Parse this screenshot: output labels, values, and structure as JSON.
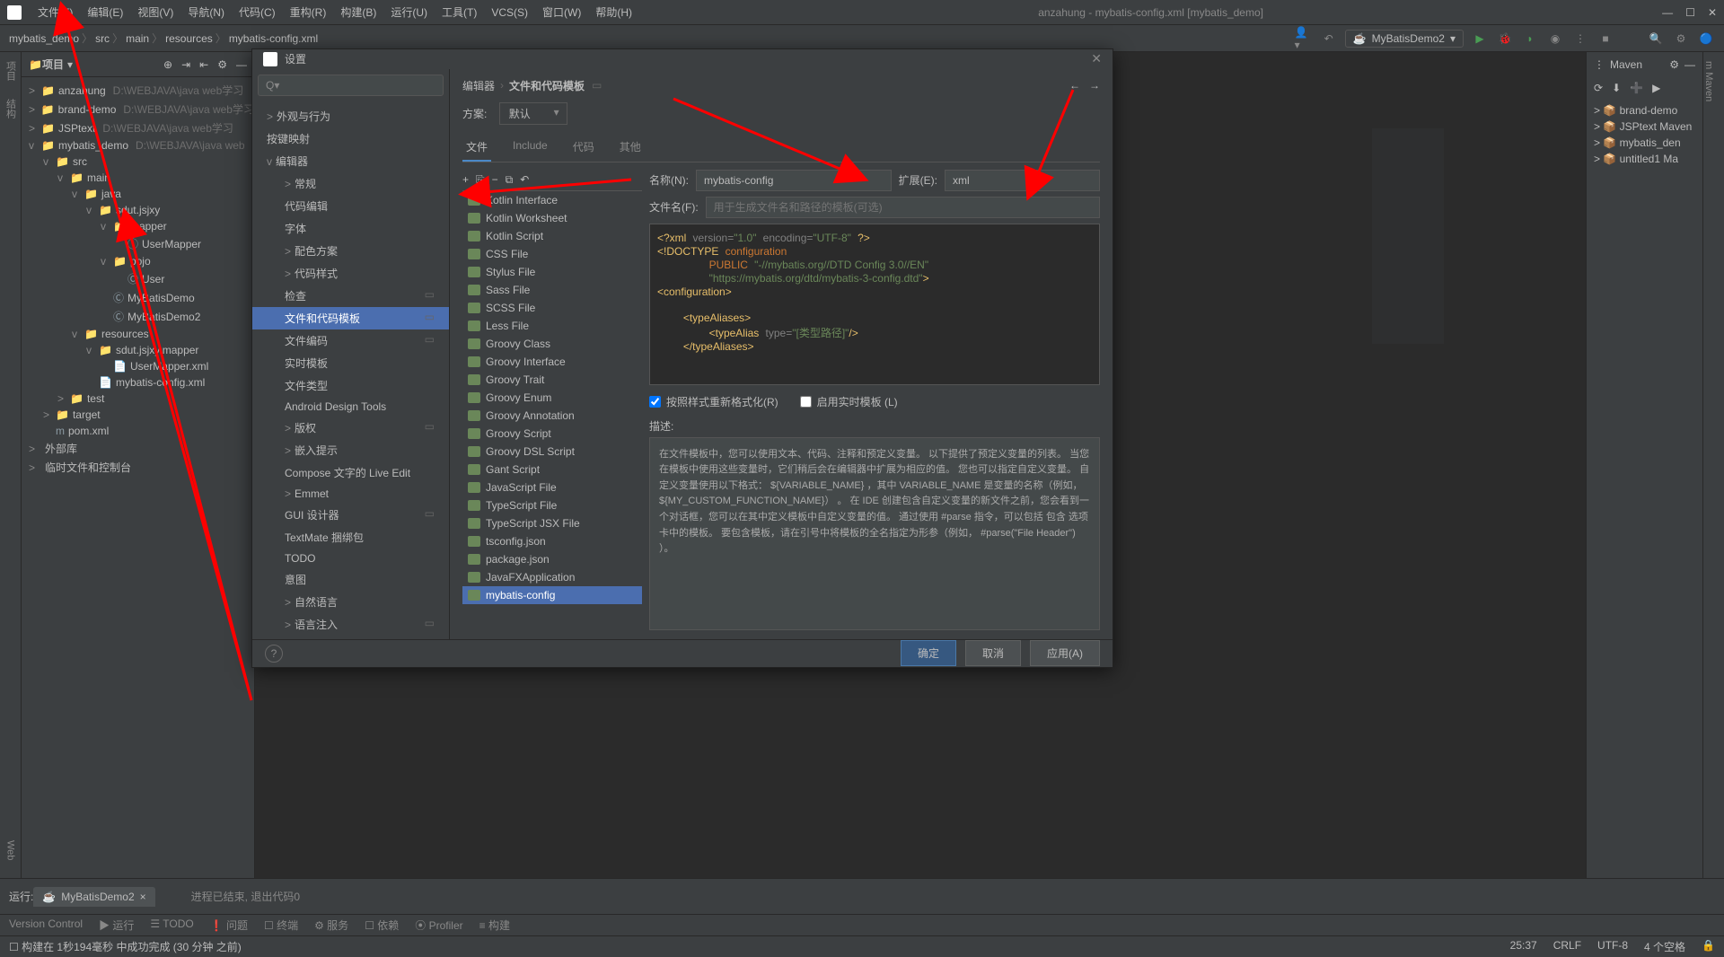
{
  "title_center": "anzahung - mybatis-config.xml [mybatis_demo]",
  "menu": [
    "文件(F)",
    "编辑(E)",
    "视图(V)",
    "导航(N)",
    "代码(C)",
    "重构(R)",
    "构建(B)",
    "运行(U)",
    "工具(T)",
    "VCS(S)",
    "窗口(W)",
    "帮助(H)"
  ],
  "breadcrumbs": [
    "mybatis_demo",
    "src",
    "main",
    "resources",
    "mybatis-config.xml"
  ],
  "run_config": "MyBatisDemo2",
  "maven_label": "Maven",
  "project_label": "项目",
  "project_tree": [
    {
      "lvl": 0,
      "arrow": ">",
      "icon": "📁",
      "name": "anzahung",
      "path": "D:\\WEBJAVA\\java web学习"
    },
    {
      "lvl": 0,
      "arrow": ">",
      "icon": "📁",
      "name": "brand-demo",
      "path": "D:\\WEBJAVA\\java web学习"
    },
    {
      "lvl": 0,
      "arrow": ">",
      "icon": "📁",
      "name": "JSPtext",
      "path": "D:\\WEBJAVA\\java web学习"
    },
    {
      "lvl": 0,
      "arrow": "v",
      "icon": "📁",
      "name": "mybatis_demo",
      "path": "D:\\WEBJAVA\\java web"
    },
    {
      "lvl": 1,
      "arrow": "v",
      "icon": "📁",
      "name": "src"
    },
    {
      "lvl": 2,
      "arrow": "v",
      "icon": "📁",
      "name": "main"
    },
    {
      "lvl": 3,
      "arrow": "v",
      "icon": "📁",
      "name": "java"
    },
    {
      "lvl": 4,
      "arrow": "v",
      "icon": "📁",
      "name": "sdut.jsjxy"
    },
    {
      "lvl": 5,
      "arrow": "v",
      "icon": "📁",
      "name": "mapper"
    },
    {
      "lvl": 6,
      "arrow": "",
      "icon": "Ⓘ",
      "name": "UserMapper"
    },
    {
      "lvl": 5,
      "arrow": "v",
      "icon": "📁",
      "name": "pojo"
    },
    {
      "lvl": 6,
      "arrow": "",
      "icon": "Ⓒ",
      "name": "User"
    },
    {
      "lvl": 5,
      "arrow": "",
      "icon": "Ⓒ",
      "name": "MyBatisDemo"
    },
    {
      "lvl": 5,
      "arrow": "",
      "icon": "Ⓒ",
      "name": "MyBatisDemo2"
    },
    {
      "lvl": 3,
      "arrow": "v",
      "icon": "📁",
      "name": "resources"
    },
    {
      "lvl": 4,
      "arrow": "v",
      "icon": "📁",
      "name": "sdut.jsjxy.mapper"
    },
    {
      "lvl": 5,
      "arrow": "",
      "icon": "📄",
      "name": "UserMapper.xml"
    },
    {
      "lvl": 4,
      "arrow": "",
      "icon": "📄",
      "name": "mybatis-config.xml"
    },
    {
      "lvl": 2,
      "arrow": ">",
      "icon": "📁",
      "name": "test"
    },
    {
      "lvl": 1,
      "arrow": ">",
      "icon": "📁",
      "name": "target"
    },
    {
      "lvl": 1,
      "arrow": "",
      "icon": "m",
      "name": "pom.xml"
    },
    {
      "lvl": 0,
      "arrow": ">",
      "icon": "",
      "name": "外部库"
    },
    {
      "lvl": 0,
      "arrow": ">",
      "icon": "",
      "name": "临时文件和控制台"
    }
  ],
  "maven_tree": [
    "brand-demo",
    "JSPtext Maven",
    "mybatis_den",
    "untitled1 Ma"
  ],
  "run_panel": {
    "label": "运行:",
    "tab": "MyBatisDemo2",
    "output": "进程已结束, 退出代码0"
  },
  "bottom_tabs": [
    "Version Control",
    "▶ 运行",
    "☰ TODO",
    "❗ 问题",
    "☐ 终端",
    "⚙ 服务",
    "☐ 依赖",
    "⦿ Profiler",
    "≡ 构建"
  ],
  "status_left": "☐ 构建在 1秒194毫秒 中成功完成 (30 分钟 之前)",
  "status_right": [
    "25:37",
    "CRLF",
    "UTF-8",
    "4 个空格",
    "🔒"
  ],
  "dialog": {
    "title": "设置",
    "search_placeholder": "Q▾",
    "categories": [
      {
        "label": "外观与行为",
        "arrow": ">"
      },
      {
        "label": "按键映射"
      },
      {
        "label": "编辑器",
        "arrow": "v"
      },
      {
        "label": "常规",
        "arrow": ">",
        "sub": true
      },
      {
        "label": "代码编辑",
        "sub": true
      },
      {
        "label": "字体",
        "sub": true
      },
      {
        "label": "配色方案",
        "arrow": ">",
        "sub": true
      },
      {
        "label": "代码样式",
        "arrow": ">",
        "sub": true
      },
      {
        "label": "检查",
        "sub": true,
        "badge": true
      },
      {
        "label": "文件和代码模板",
        "sub": true,
        "selected": true,
        "badge": true
      },
      {
        "label": "文件编码",
        "sub": true,
        "badge": true
      },
      {
        "label": "实时模板",
        "sub": true
      },
      {
        "label": "文件类型",
        "sub": true
      },
      {
        "label": "Android Design Tools",
        "sub": true
      },
      {
        "label": "版权",
        "arrow": ">",
        "sub": true,
        "badge": true
      },
      {
        "label": "嵌入提示",
        "arrow": ">",
        "sub": true
      },
      {
        "label": "Compose 文字的 Live Edit",
        "sub": true
      },
      {
        "label": "Emmet",
        "arrow": ">",
        "sub": true
      },
      {
        "label": "GUI 设计器",
        "sub": true,
        "badge": true
      },
      {
        "label": "TextMate 捆绑包",
        "sub": true
      },
      {
        "label": "TODO",
        "sub": true
      },
      {
        "label": "意图",
        "sub": true
      },
      {
        "label": "自然语言",
        "arrow": ">",
        "sub": true
      },
      {
        "label": "语言注入",
        "arrow": ">",
        "sub": true,
        "badge": true
      }
    ],
    "breadcrumb": [
      "编辑器",
      "文件和代码模板"
    ],
    "scheme_label": "方案:",
    "scheme_value": "默认",
    "tabs": [
      "文件",
      "Include",
      "代码",
      "其他"
    ],
    "active_tab": "文件",
    "template_list": [
      "Kotlin Interface",
      "Kotlin Worksheet",
      "Kotlin Script",
      "CSS File",
      "Stylus File",
      "Sass File",
      "SCSS File",
      "Less File",
      "Groovy Class",
      "Groovy Interface",
      "Groovy Trait",
      "Groovy Enum",
      "Groovy Annotation",
      "Groovy Script",
      "Groovy DSL Script",
      "Gant Script",
      "JavaScript File",
      "TypeScript File",
      "TypeScript JSX File",
      "tsconfig.json",
      "package.json",
      "JavaFXApplication",
      "mybatis-config"
    ],
    "selected_template": "mybatis-config",
    "name_label": "名称(N):",
    "name_value": "mybatis-config",
    "ext_label": "扩展(E):",
    "ext_value": "xml",
    "filename_label": "文件名(F):",
    "filename_placeholder": "用于生成文件名和路径的模板(可选)",
    "checkbox1": "按照样式重新格式化(R)",
    "checkbox2": "启用实时模板 (L)",
    "desc_label": "描述:",
    "desc_text": "在文件模板中，您可以使用文本、代码、注释和预定义变量。 以下提供了预定义变量的列表。 当您在模板中使用这些变量时，它们稍后会在编辑器中扩展为相应的值。\n\n您也可以指定自定义变量。 自定义变量使用以下格式： ${VARIABLE_NAME} ，其中 VARIABLE_NAME 是变量的名称（例如，${MY_CUSTOM_FUNCTION_NAME}） 。 在 IDE 创建包含自定义变量的新文件之前，您会看到一个对话框，您可以在其中定义模板中自定义变量的值。\n\n通过使用 #parse 指令，可以包括 包含 选项卡中的模板。 要包含模板，请在引号中将模板的全名指定为形参（例如， #parse(\"File Header\") ）。",
    "btn_ok": "确定",
    "btn_cancel": "取消",
    "btn_apply": "应用(A)"
  }
}
